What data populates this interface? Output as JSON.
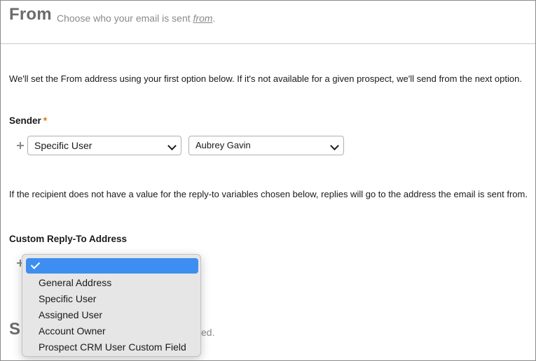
{
  "header": {
    "title": "From",
    "subtitle_prefix": "Choose who your email is sent ",
    "subtitle_emph": "from",
    "subtitle_suffix": "."
  },
  "sender_section": {
    "description": "We'll set the From address using your first option below. If it's not available for a given prospect, we'll send from the next option.",
    "label": "Sender",
    "required_mark": "*",
    "type_select_value": "Specific User",
    "user_select_value": "Aubrey Gavin"
  },
  "reply_section": {
    "description": "If the recipient does not have a value for the reply-to variables chosen below, replies will go to the address the email is sent from.",
    "label": "Custom Reply-To Address"
  },
  "dropdown": {
    "options": [
      "General Address",
      "Specific User",
      "Assigned User",
      "Account Owner",
      "Prospect CRM User Custom Field"
    ]
  },
  "next_section": {
    "title_partial": "S",
    "text_partial": "ed."
  },
  "colors": {
    "accent": "#3d8ef0",
    "required": "#e07a12",
    "header_text": "#6b6b6b"
  }
}
